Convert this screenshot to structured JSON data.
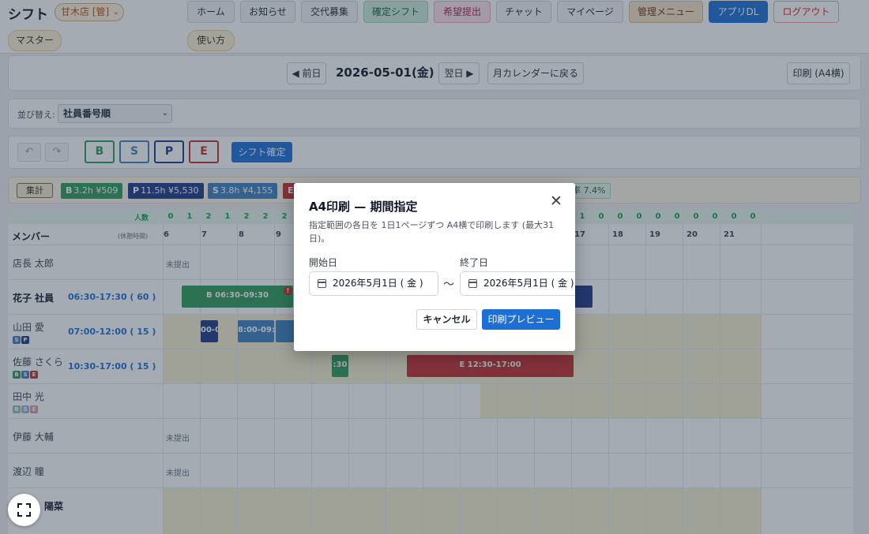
{
  "header": {
    "app_title": "シフト",
    "store_select": "甘木店 [管]",
    "nav": [
      "ホーム",
      "お知らせ",
      "交代募集",
      "確定シフト",
      "希望提出",
      "チャット",
      "マイページ",
      "管理メニュー",
      "アプリDL",
      "ログアウト"
    ],
    "nav2": [
      "マスター",
      "使い方"
    ]
  },
  "datebar": {
    "prev": "◀ 前日",
    "date": "2026-05-01(金)",
    "next": "翌日 ▶",
    "month_calendar": "月カレンダーに戻る",
    "print": "印刷 (A4横)"
  },
  "sort": {
    "label": "並び替え:",
    "value": "社員番号順"
  },
  "toolbar": {
    "undo_icon": "undo-icon",
    "redo_icon": "redo-icon",
    "types": [
      "B",
      "S",
      "P",
      "E"
    ],
    "confirm": "シフト確定"
  },
  "summary": {
    "label": "集計",
    "chips": [
      {
        "type": "B",
        "text": "3.2h ¥509",
        "color": "#2e9e5b"
      },
      {
        "type": "P",
        "text": "11.5h ¥5,530",
        "color": "#1e3a8a"
      },
      {
        "type": "S",
        "text": "3.8h ¥4,155",
        "color": "#3b82c4"
      },
      {
        "type": "E",
        "text": "",
        "color": "#c53030"
      }
    ],
    "rate": "率 7.4%"
  },
  "grid": {
    "count_label": "人数",
    "counts_left": [
      "0",
      "1",
      "2",
      "1",
      "2",
      "2",
      "2"
    ],
    "counts_right": [
      "1",
      "0",
      "0",
      "0",
      "0",
      "0",
      "0",
      "0",
      "0",
      "0"
    ],
    "header_label": "メンバー",
    "break_label": "(休憩時間)",
    "hours": [
      "6",
      "7",
      "8",
      "9",
      "17",
      "18",
      "19",
      "20",
      "21"
    ],
    "members": [
      {
        "name": "店長 太郎",
        "time": "",
        "status": "未提出",
        "roles": []
      },
      {
        "name": "花子 社員",
        "time": "06:30-17:30 ( 60 )",
        "status": "",
        "roles": []
      },
      {
        "name": "山田 愛",
        "time": "07:00-12:00 ( 15 )",
        "status": "",
        "roles": [
          "S",
          "P"
        ]
      },
      {
        "name": "佐藤 さくら",
        "time": "10:30-17:00 ( 15 )",
        "status": "",
        "roles": [
          "B",
          "S",
          "E"
        ]
      },
      {
        "name": "田中 光",
        "time": "",
        "status": "",
        "roles": [
          "B",
          "S",
          "E"
        ]
      },
      {
        "name": "伊藤 大輔",
        "time": "",
        "status": "未提出",
        "roles": []
      },
      {
        "name": "渡辺 瞳",
        "time": "",
        "status": "未提出",
        "roles": []
      },
      {
        "name": "陽菜",
        "time": "",
        "status": "",
        "roles": []
      }
    ],
    "bars": [
      {
        "label": "B 06:30-09:30",
        "color": "#2e9e5b"
      },
      {
        "label": "",
        "color": "#1e3a8a"
      },
      {
        "label": "00-0",
        "color": "#1e3a8a"
      },
      {
        "label": "8:00-09:",
        "color": "#3b82c4"
      },
      {
        "label": "",
        "color": "#3b82c4"
      },
      {
        "label": ":30",
        "color": "#2e9e5b"
      },
      {
        "label": "E 12:30-17:00",
        "color": "#c53030"
      }
    ],
    "error_mark": "!"
  },
  "modal": {
    "title": "A4印刷 — 期間指定",
    "close_icon": "close-icon",
    "description": "指定範囲の各日を 1日1ページずつ A4横で印刷します (最大31日)。",
    "start_label": "開始日",
    "start_value": "2026年5月1日 ( 金 )",
    "tilde": "〜",
    "end_label": "終了日",
    "end_value": "2026年5月1日 ( 金 )",
    "cancel": "キャンセル",
    "preview": "印刷プレビュー"
  },
  "fullscreen_icon": "fullscreen-icon"
}
